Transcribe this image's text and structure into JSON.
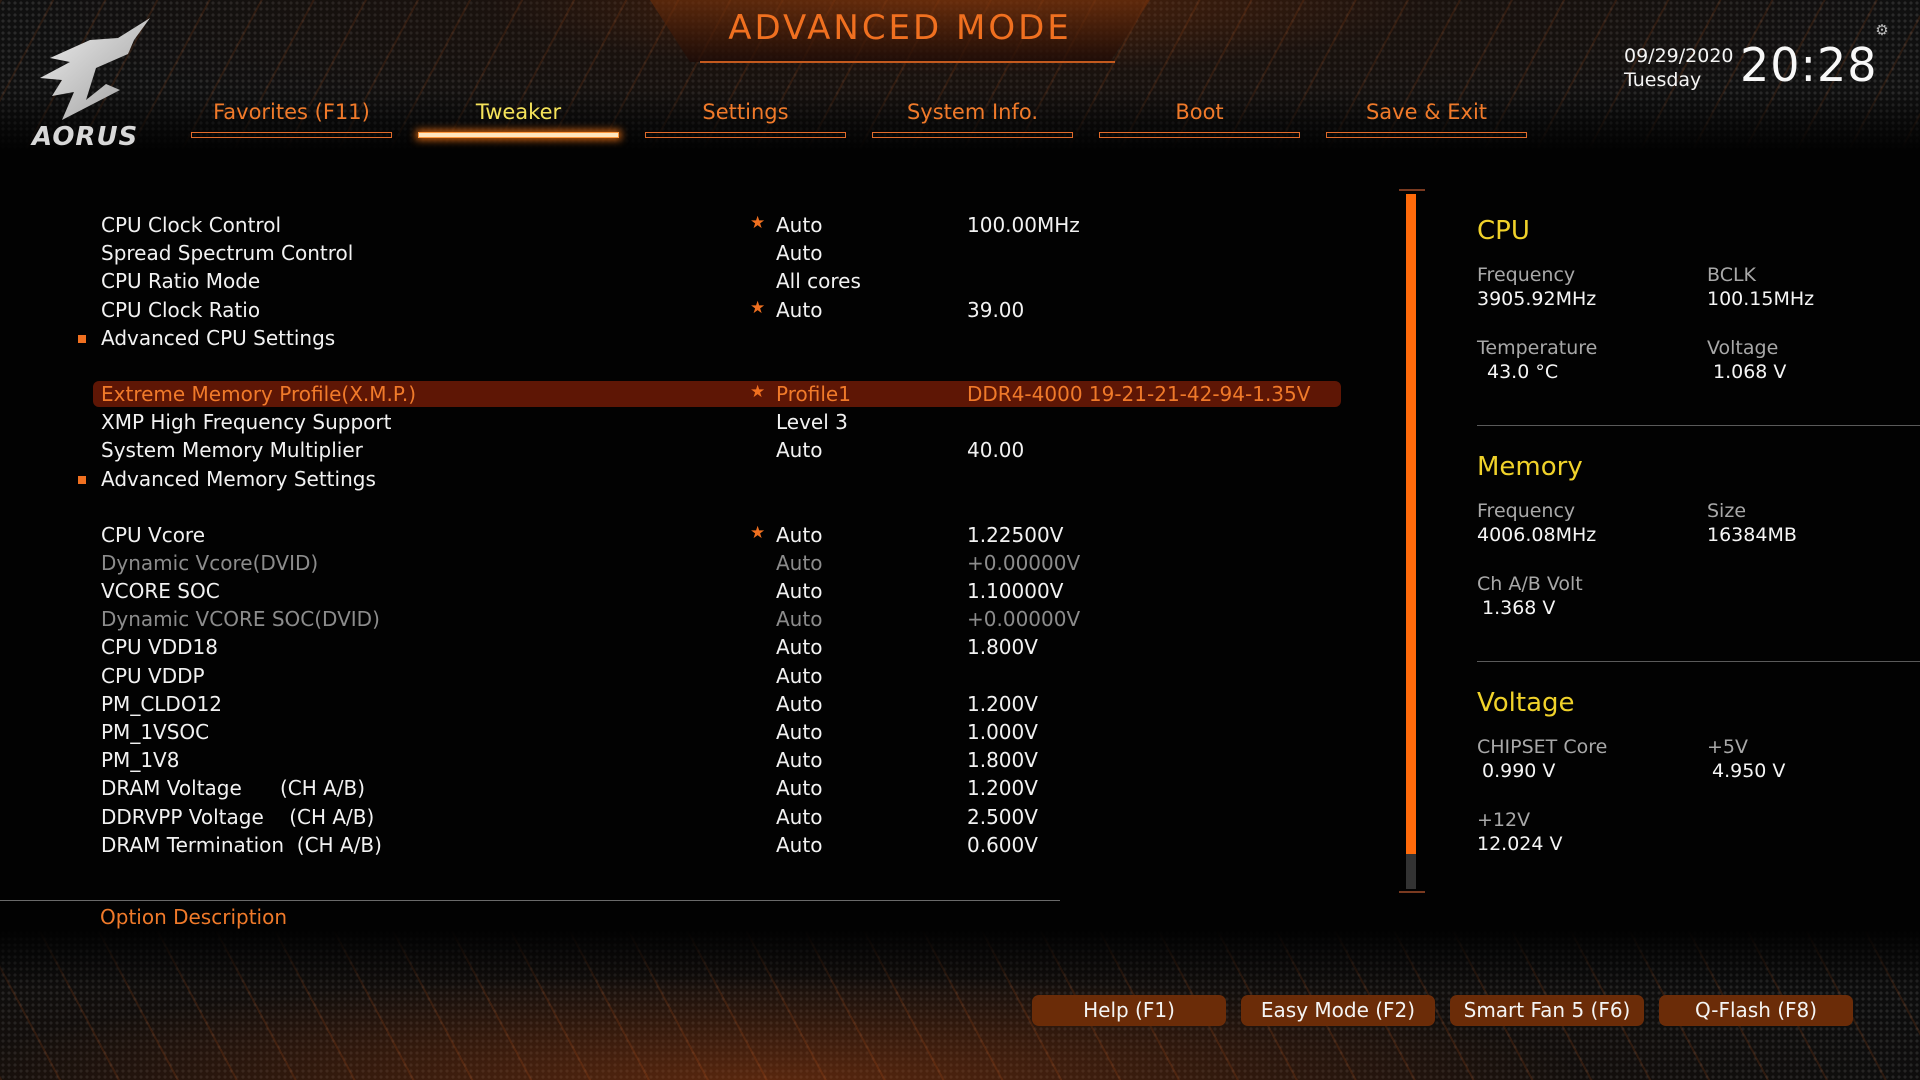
{
  "brand": {
    "logo_text": "AORUS"
  },
  "header": {
    "title": "ADVANCED MODE",
    "date": "09/29/2020",
    "weekday": "Tuesday",
    "time": "20:28",
    "settings_icon": "gear-icon"
  },
  "tabs": [
    {
      "label": "Favorites (F11)",
      "active": false
    },
    {
      "label": "Tweaker",
      "active": true
    },
    {
      "label": "Settings",
      "active": false
    },
    {
      "label": "System Info.",
      "active": false
    },
    {
      "label": "Boot",
      "active": false
    },
    {
      "label": "Save & Exit",
      "active": false
    }
  ],
  "settings": [
    {
      "name": "CPU Clock Control",
      "value": "Auto",
      "value2": "100.00MHz",
      "starred": true
    },
    {
      "name": "Spread Spectrum Control",
      "value": "Auto",
      "value2": "",
      "starred": false
    },
    {
      "name": "CPU Ratio Mode",
      "value": "All cores",
      "value2": "",
      "starred": false
    },
    {
      "name": "CPU Clock Ratio",
      "value": "Auto",
      "value2": "39.00",
      "starred": true
    },
    {
      "name": "Advanced CPU Settings",
      "submenu": true
    },
    {
      "spacer": true
    },
    {
      "name": "Extreme Memory Profile(X.M.P.)",
      "value": "Profile1",
      "value2": "DDR4-4000 19-21-21-42-94-1.35V",
      "starred": true,
      "selected": true
    },
    {
      "name": "XMP High Frequency Support",
      "value": "Level 3",
      "value2": "",
      "starred": false
    },
    {
      "name": "System Memory Multiplier",
      "value": "Auto",
      "value2": "40.00",
      "starred": false
    },
    {
      "name": "Advanced Memory Settings",
      "submenu": true
    },
    {
      "spacer": true
    },
    {
      "name": "CPU Vcore",
      "value": "Auto",
      "value2": "1.22500V",
      "starred": true
    },
    {
      "name": "Dynamic Vcore(DVID)",
      "value": "Auto",
      "value2": "+0.00000V",
      "starred": false,
      "disabled": true
    },
    {
      "name": "VCORE SOC",
      "value": "Auto",
      "value2": "1.10000V",
      "starred": false
    },
    {
      "name": "Dynamic VCORE SOC(DVID)",
      "value": "Auto",
      "value2": "+0.00000V",
      "starred": false,
      "disabled": true
    },
    {
      "name": "CPU VDD18",
      "value": "Auto",
      "value2": "1.800V",
      "starred": false
    },
    {
      "name": "CPU VDDP",
      "value": "Auto",
      "value2": "",
      "starred": false
    },
    {
      "name": "PM_CLDO12",
      "value": "Auto",
      "value2": "1.200V",
      "starred": false
    },
    {
      "name": "PM_1VSOC",
      "value": "Auto",
      "value2": "1.000V",
      "starred": false
    },
    {
      "name": "PM_1V8",
      "value": "Auto",
      "value2": "1.800V",
      "starred": false
    },
    {
      "name": "DRAM Voltage      (CH A/B)",
      "value": "Auto",
      "value2": "1.200V",
      "starred": false
    },
    {
      "name": "DDRVPP Voltage    (CH A/B)",
      "value": "Auto",
      "value2": "2.500V",
      "starred": false
    },
    {
      "name": "DRAM Termination  (CH A/B)",
      "value": "Auto",
      "value2": "0.600V",
      "starred": false
    }
  ],
  "scrollbar": {
    "visible_fraction": 0.95
  },
  "info_panel": {
    "cpu": {
      "title": "CPU",
      "frequency_label": "Frequency",
      "frequency": "3905.92MHz",
      "bclk_label": "BCLK",
      "bclk": "100.15MHz",
      "temperature_label": "Temperature",
      "temperature": "43.0 °C",
      "voltage_label": "Voltage",
      "voltage": "1.068 V"
    },
    "memory": {
      "title": "Memory",
      "frequency_label": "Frequency",
      "frequency": "4006.08MHz",
      "size_label": "Size",
      "size": "16384MB",
      "volt_label": "Ch A/B Volt",
      "volt": "1.368 V"
    },
    "voltage": {
      "title": "Voltage",
      "chipset_label": "CHIPSET Core",
      "chipset": "0.990 V",
      "v5_label": "+5V",
      "v5": "4.950 V",
      "v12_label": "+12V",
      "v12": "12.024 V"
    }
  },
  "option_description": {
    "label": "Option Description"
  },
  "function_buttons": [
    {
      "label": "Help (F1)"
    },
    {
      "label": "Easy Mode (F2)"
    },
    {
      "label": "Smart Fan 5 (F6)"
    },
    {
      "label": "Q-Flash (F8)"
    }
  ],
  "colors": {
    "accent": "#f07020",
    "highlight_row": "#5e1605",
    "section_title": "#f0d22a",
    "tab_active": "#f5e35a"
  }
}
